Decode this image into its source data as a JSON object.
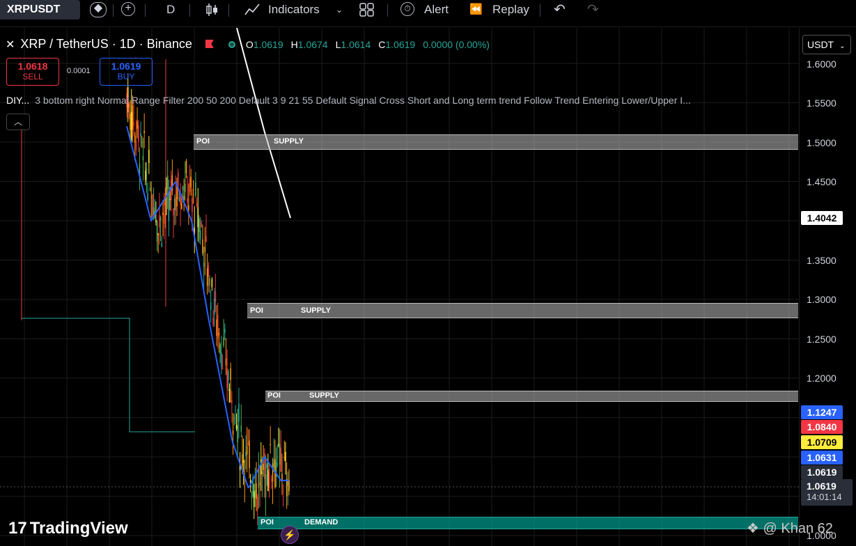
{
  "toolbar": {
    "symbol": "XRPUSDT",
    "interval": "D",
    "indicators_label": "Indicators",
    "alert_label": "Alert",
    "replay_label": "Replay"
  },
  "legend": {
    "title": "XRP / TetherUS · 1D · Binance",
    "o_label": "O",
    "o_value": "1.0619",
    "h_label": "H",
    "h_value": "1.0674",
    "l_label": "L",
    "l_value": "1.0614",
    "c_label": "C",
    "c_value": "1.0619",
    "change": "0.0000 (0.00%)"
  },
  "trade": {
    "sell_price": "1.0618",
    "sell_label": "SELL",
    "spread": "0.0001",
    "buy_price": "1.0619",
    "buy_label": "BUY"
  },
  "indicator_line": {
    "name": "DIY...",
    "params": "3 bottom right Normal Range Filter 200 50 200 Default 3 9 21 55 Default Signal Cross Short and Long term trend Follow Trend Entering Lower/Upper I..."
  },
  "zones": [
    {
      "poi": "POI",
      "kind": "SUPPLY"
    },
    {
      "poi": "POI",
      "kind": "SUPPLY"
    },
    {
      "poi": "POI",
      "kind": "SUPPLY"
    },
    {
      "poi": "POI",
      "kind": "DEMAND"
    }
  ],
  "price_axis": {
    "unit": "USDT",
    "ticks": [
      "1.6000",
      "1.5500",
      "1.5000",
      "1.4500",
      "1.3500",
      "1.3000",
      "1.2500",
      "1.2000",
      "1.0000"
    ],
    "tags": [
      {
        "value": "1.4042",
        "bg": "#ffffff",
        "fg": "#000000"
      },
      {
        "value": "1.1247",
        "bg": "#2962ff",
        "fg": "#ffffff"
      },
      {
        "value": "1.0840",
        "bg": "#f23645",
        "fg": "#ffffff"
      },
      {
        "value": "1.0709",
        "bg": "#ffeb3b",
        "fg": "#000000"
      },
      {
        "value": "1.0631",
        "bg": "#2962ff",
        "fg": "#ffffff"
      },
      {
        "value": "1.0619",
        "bg": "#2a2e39",
        "fg": "#ffffff"
      }
    ],
    "last_price": "1.0619",
    "countdown": "14:01:14"
  },
  "branding": {
    "logo_text": "TradingView",
    "watermark": "@ Khan 62"
  },
  "colors": {
    "up": "#26a69a",
    "down": "#f23645",
    "ma": "#2962ff",
    "accent_yellow": "#ffeb3b"
  }
}
